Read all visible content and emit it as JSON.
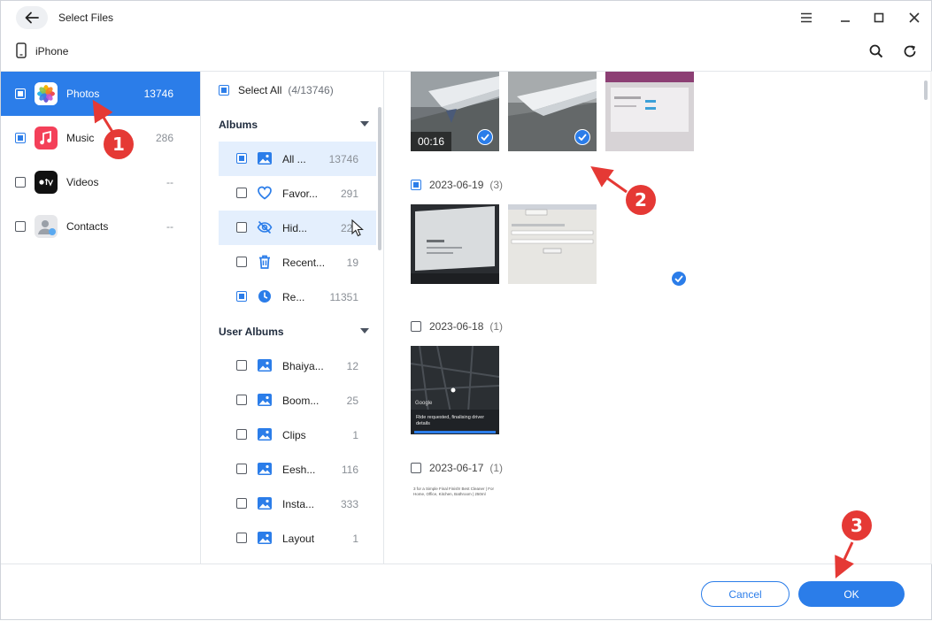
{
  "window": {
    "title": "Select Files"
  },
  "device": {
    "name": "iPhone"
  },
  "categories": [
    {
      "label": "Photos",
      "count": "13746",
      "active": true
    },
    {
      "label": "Music",
      "count": "286",
      "active": false
    },
    {
      "label": "Videos",
      "count": "--",
      "active": false
    },
    {
      "label": "Contacts",
      "count": "--",
      "active": false
    }
  ],
  "albums": {
    "select_all_label": "Select All",
    "select_all_count": "(4/13746)",
    "albums_header": "Albums",
    "user_albums_header": "User Albums",
    "system": [
      {
        "name": "All ...",
        "count": "13746",
        "icon": "image-icon",
        "checked": "partial",
        "selected": true
      },
      {
        "name": "Favor...",
        "count": "291",
        "icon": "heart-icon",
        "checked": "none",
        "selected": false
      },
      {
        "name": "Hid...",
        "count": "228",
        "icon": "hidden-eye-icon",
        "checked": "none",
        "selected": false
      },
      {
        "name": "Recent...",
        "count": "19",
        "icon": "trash-icon",
        "checked": "none",
        "selected": false
      },
      {
        "name": "Re...",
        "count": "11351",
        "icon": "clock-icon",
        "checked": "partial",
        "selected": false
      }
    ],
    "user": [
      {
        "name": "Bhaiya...",
        "count": "12",
        "icon": "image-icon"
      },
      {
        "name": "Boom...",
        "count": "25",
        "icon": "image-icon"
      },
      {
        "name": "Clips",
        "count": "1",
        "icon": "image-icon"
      },
      {
        "name": "Eesh...",
        "count": "116",
        "icon": "image-icon"
      },
      {
        "name": "Insta...",
        "count": "333",
        "icon": "image-icon"
      },
      {
        "name": "Layout",
        "count": "1",
        "icon": "image-icon"
      }
    ]
  },
  "grid": {
    "video_duration": "00:16",
    "groups": [
      {
        "date": "2023-06-19",
        "count": "(3)",
        "checked": "partial"
      },
      {
        "date": "2023-06-18",
        "count": "(1)",
        "checked": "none"
      },
      {
        "date": "2023-06-17",
        "count": "(1)",
        "checked": "none"
      }
    ],
    "map_caption": "Ride requested, finalising driver details",
    "map_brand": "Google",
    "doc_text": "3 for a Simple Final Finish! Best Cleaner | For Home, Office, Kitchen, Bathroom | 250ml"
  },
  "footer": {
    "cancel_label": "Cancel",
    "ok_label": "OK"
  },
  "annotations": [
    "1",
    "2",
    "3"
  ],
  "colors": {
    "accent": "#2b7de9",
    "annotation": "#e53935"
  }
}
